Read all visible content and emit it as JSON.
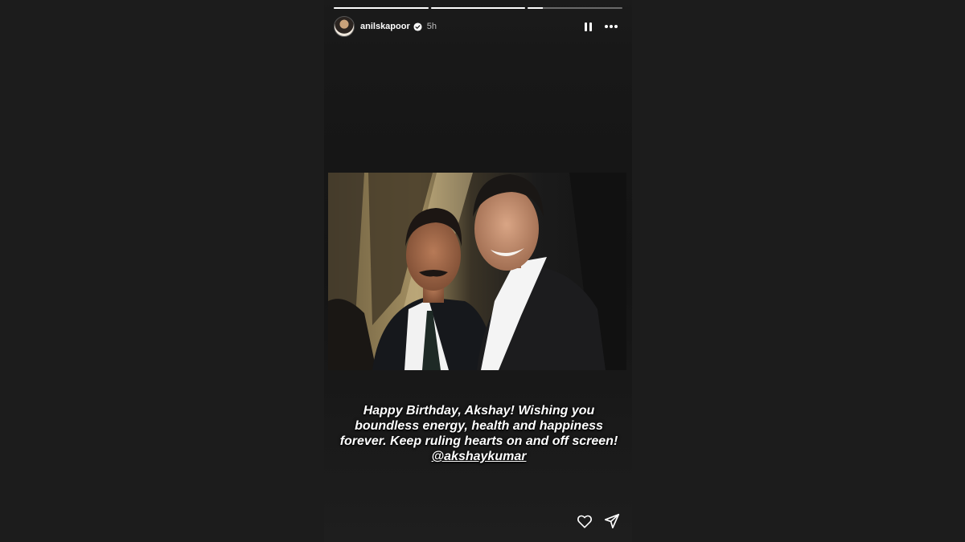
{
  "story": {
    "progress": [
      {
        "fill": 1.0
      },
      {
        "fill": 1.0
      },
      {
        "fill": 0.16
      }
    ],
    "header": {
      "username": "anilskapoor",
      "verified_icon": "verified-badge-icon",
      "time": "5h",
      "pause_icon": "pause-icon",
      "more_icon": "more-options-icon"
    },
    "caption": {
      "text": "Happy Birthday, Akshay! Wishing you boundless energy, health and happiness forever. Keep ruling hearts on and off screen!",
      "mention": "@akshaykumar"
    },
    "actions": {
      "like_icon": "heart-icon",
      "share_icon": "send-icon"
    }
  }
}
